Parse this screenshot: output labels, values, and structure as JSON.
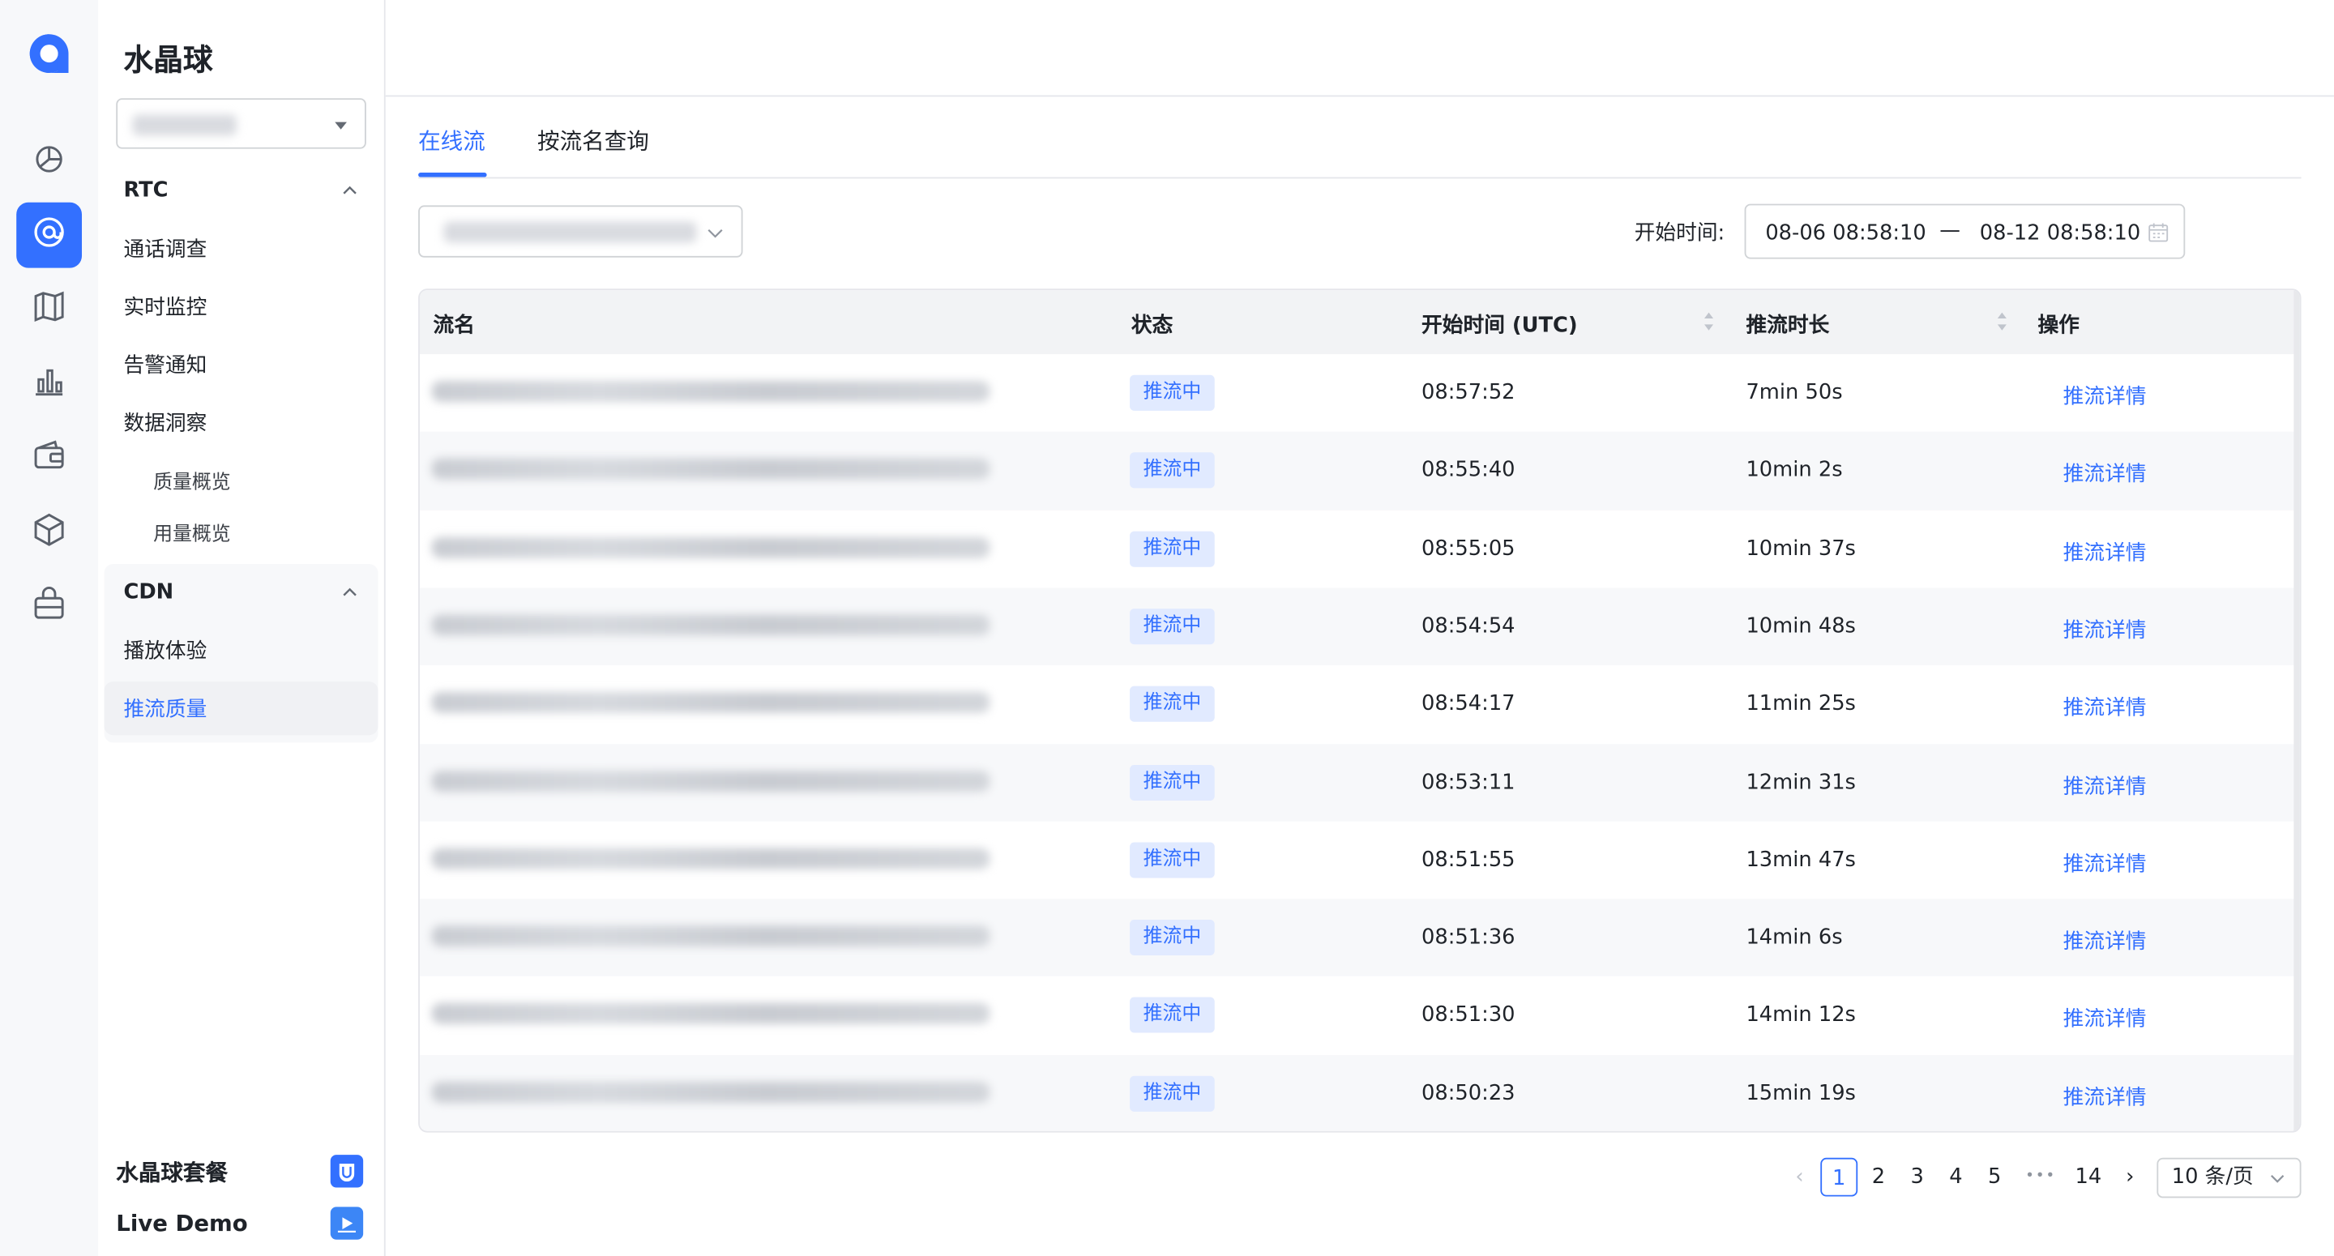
{
  "app": {
    "title": "水晶球",
    "project_select_value": "",
    "colors": {
      "accent": "#3370ff",
      "badge_bg": "#e1eaff",
      "rail_bg": "#f7f8fa"
    }
  },
  "rail": {
    "items": [
      {
        "icon": "pie-chart-icon",
        "active": false
      },
      {
        "icon": "at-sign-icon",
        "active": true
      },
      {
        "icon": "map-icon",
        "active": false
      },
      {
        "icon": "bar-chart-icon",
        "active": false
      },
      {
        "icon": "wallet-icon",
        "active": false
      },
      {
        "icon": "cube-icon",
        "active": false
      },
      {
        "icon": "briefcase-icon",
        "active": false
      }
    ]
  },
  "sidebar": {
    "groups": [
      {
        "label": "RTC",
        "expanded": true,
        "items": [
          "通话调查",
          "实时监控",
          "告警通知",
          "数据洞察"
        ],
        "sub_items": [
          "质量概览",
          "用量概览"
        ]
      },
      {
        "label": "CDN",
        "expanded": true,
        "items": [
          "播放体验",
          "推流质量"
        ],
        "active_item": "推流质量"
      }
    ],
    "bottom": [
      {
        "label": "水晶球套餐",
        "icon": "package-icon"
      },
      {
        "label": "Live Demo",
        "icon": "play-icon"
      }
    ]
  },
  "tabs": [
    {
      "label": "在线流",
      "active": true
    },
    {
      "label": "按流名查询",
      "active": false
    }
  ],
  "filters": {
    "stream_select_value": "",
    "date_label": "开始时间:",
    "date_start": "08-06 08:58:10",
    "date_separator": "—",
    "date_end": "08-12 08:58:10"
  },
  "table": {
    "columns": [
      "流名",
      "状态",
      "开始时间 (UTC)",
      "推流时长",
      "操作"
    ],
    "rows": [
      {
        "stream_name": "",
        "status": "推流中",
        "start_time": "08:57:52",
        "duration": "7min 50s",
        "action": "推流详情"
      },
      {
        "stream_name": "",
        "status": "推流中",
        "start_time": "08:55:40",
        "duration": "10min 2s",
        "action": "推流详情"
      },
      {
        "stream_name": "",
        "status": "推流中",
        "start_time": "08:55:05",
        "duration": "10min 37s",
        "action": "推流详情"
      },
      {
        "stream_name": "",
        "status": "推流中",
        "start_time": "08:54:54",
        "duration": "10min 48s",
        "action": "推流详情"
      },
      {
        "stream_name": "",
        "status": "推流中",
        "start_time": "08:54:17",
        "duration": "11min 25s",
        "action": "推流详情"
      },
      {
        "stream_name": "",
        "status": "推流中",
        "start_time": "08:53:11",
        "duration": "12min 31s",
        "action": "推流详情"
      },
      {
        "stream_name": "",
        "status": "推流中",
        "start_time": "08:51:55",
        "duration": "13min 47s",
        "action": "推流详情"
      },
      {
        "stream_name": "",
        "status": "推流中",
        "start_time": "08:51:36",
        "duration": "14min 6s",
        "action": "推流详情"
      },
      {
        "stream_name": "",
        "status": "推流中",
        "start_time": "08:51:30",
        "duration": "14min 12s",
        "action": "推流详情"
      },
      {
        "stream_name": "",
        "status": "推流中",
        "start_time": "08:50:23",
        "duration": "15min 19s",
        "action": "推流详情"
      }
    ]
  },
  "pagination": {
    "pages": [
      "1",
      "2",
      "3",
      "4",
      "5"
    ],
    "ellipsis": "•••",
    "last_page": "14",
    "current": "1",
    "page_size": "10 条/页"
  }
}
